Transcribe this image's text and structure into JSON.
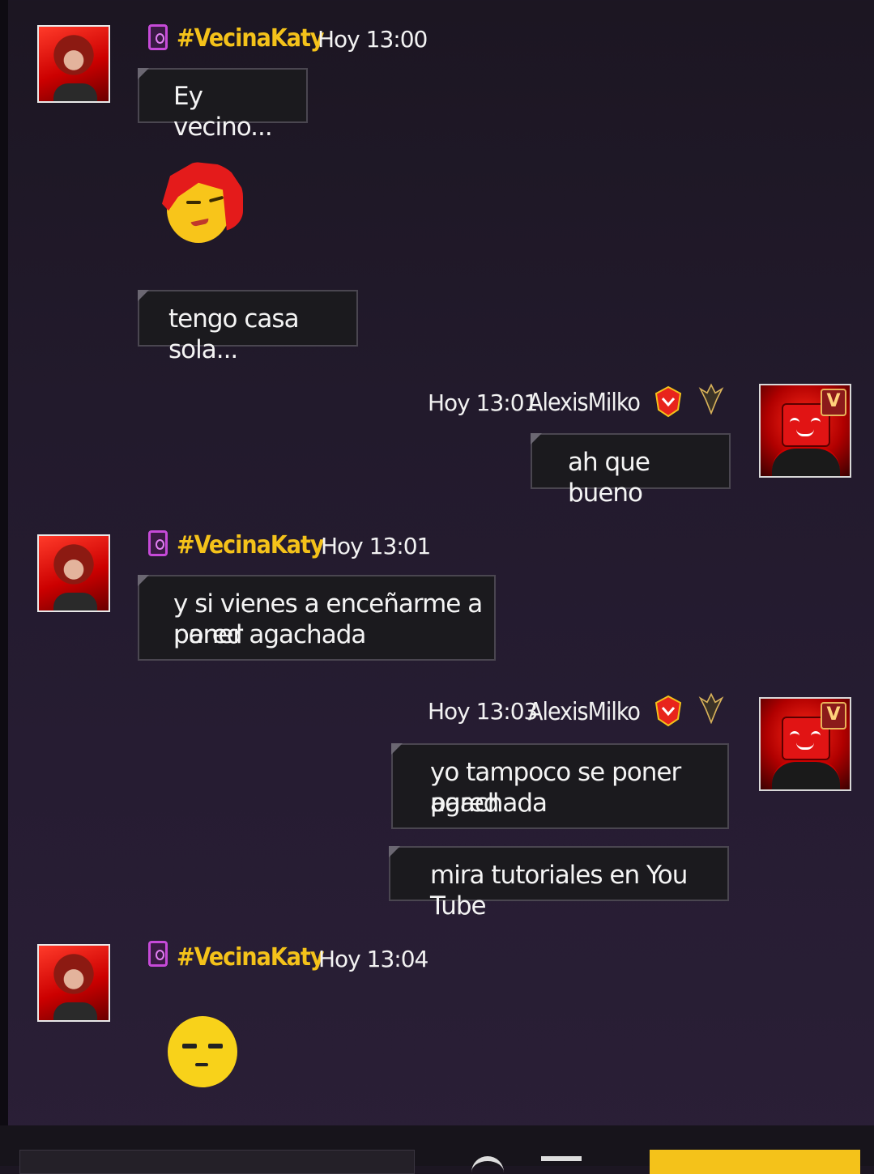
{
  "messages": [
    {
      "sender": "#VecinaKaty",
      "time": "Hoy 13:00",
      "text": "Ey vecino..."
    },
    {
      "sender": "#VecinaKaty",
      "text": "tengo casa sola..."
    },
    {
      "sender": "AlexisMilko",
      "time": "Hoy 13:01",
      "text": "ah que bueno"
    },
    {
      "sender": "#VecinaKaty",
      "time": "Hoy 13:01",
      "line1": "y si vienes a enceñarme a poner",
      "line2": "pared agachada"
    },
    {
      "sender": "AlexisMilko",
      "time": "Hoy 13:03",
      "line1": "yo tampoco se poner pared",
      "line2": "agachada"
    },
    {
      "sender": "AlexisMilko",
      "text": "mira tutoriales en You Tube"
    },
    {
      "sender": "#VecinaKaty",
      "time": "Hoy 13:04"
    }
  ],
  "icons": {
    "vip_badge": "V",
    "phone": "phone-icon",
    "rank1": "rank-shield-icon",
    "rank2": "rank-wings-icon"
  },
  "colors": {
    "name_highlight": "#f4c21a",
    "send_button": "#f4c21a"
  }
}
